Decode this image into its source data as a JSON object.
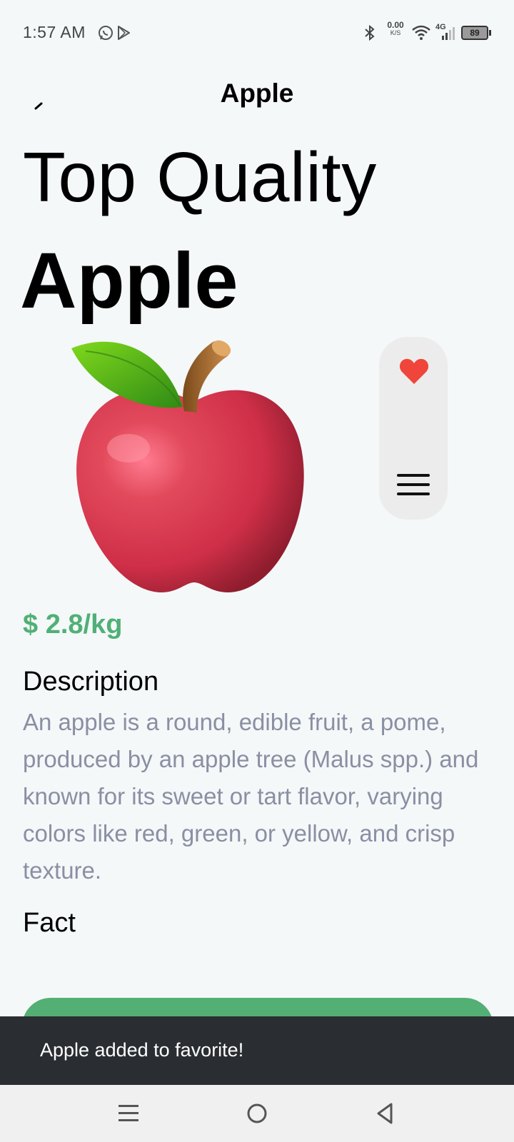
{
  "status_bar": {
    "time": "1:57 AM",
    "net_speed_value": "0.00",
    "net_speed_unit": "K/S",
    "network_type": "4G",
    "battery": "89"
  },
  "header": {
    "title": "Apple"
  },
  "hero": {
    "line1": "Top Quality",
    "line2": "Apple"
  },
  "product": {
    "image_icon": "red-apple",
    "price": "$ 2.8/kg",
    "description_title": "Description",
    "description": "An apple is a round, edible fruit, a pome, produced by an apple tree (Malus spp.) and known for its sweet or tart flavor, varying colors like red, green, or yellow, and crisp texture.",
    "fact_title": "Fact",
    "fact_text": ""
  },
  "actions": {
    "favorite_icon": "heart",
    "menu_icon": "hamburger"
  },
  "snackbar": {
    "message": "Apple added to favorite!"
  },
  "nav_bar": {
    "icons": [
      "recents-icon",
      "home-icon",
      "back-icon"
    ]
  },
  "colors": {
    "accent": "#53af73",
    "price": "#50b075",
    "heart": "#f0453a",
    "description": "#8a8fa3",
    "snackbar_bg": "#2a2d31"
  }
}
